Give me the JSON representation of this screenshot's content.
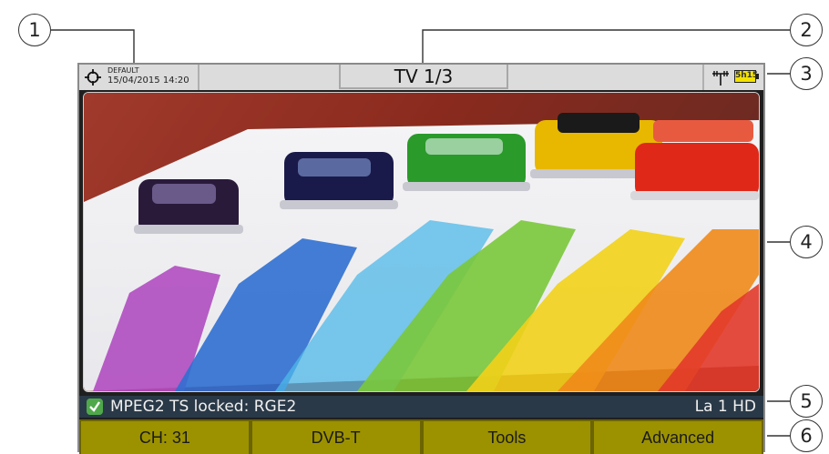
{
  "status": {
    "preset": "DEFAULT",
    "datetime": "15/04/2015 14:20",
    "title": "TV 1/3",
    "battery": "5h15"
  },
  "lock": {
    "text": "MPEG2 TS locked: RGE2",
    "service": "La 1 HD"
  },
  "softkeys": [
    "CH: 31",
    "DVB-T",
    "Tools",
    "Advanced"
  ],
  "callouts": [
    "1",
    "2",
    "3",
    "4",
    "5",
    "6"
  ],
  "colors": {
    "statusbar": "#dcdcdc",
    "lockbar": "#2a3947",
    "softkey": "#9c9200",
    "battery": "#f4e300",
    "lock_ok": "#4fa94a"
  },
  "icons": {
    "locate": "crosshair-icon",
    "signal": "antenna-icon",
    "battery": "battery-icon",
    "lock": "checkmark-icon"
  }
}
